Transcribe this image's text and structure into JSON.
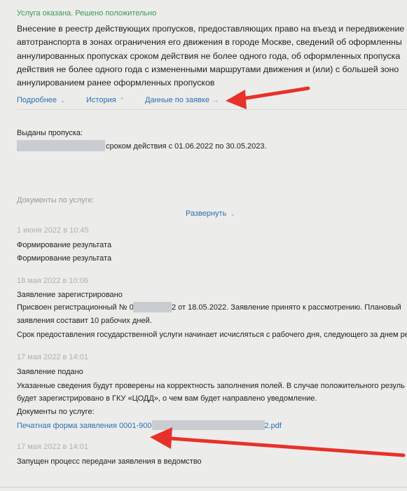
{
  "status": "Услуга оказана. Решено положительно",
  "title_lines": [
    "Внесение в реестр действующих пропусков, предоставляющих право на въезд и передвижение",
    "автотранспорта в зонах ограничения его движения в городе Москве, сведений об оформленны",
    "аннулированных пропусках сроком действия не более одного года, об оформленных пропуска",
    "действия не более одного года с измененными маршрутами движения и (или) с большей зоно",
    "аннулированием ранее оформленных пропусков"
  ],
  "links": {
    "more": "Подробнее",
    "history": "История",
    "request_data": "Данные по заявке",
    "request_arrow": "→"
  },
  "issued": {
    "label": "Выданы пропуска:",
    "text": "сроком действия с 01.06.2022 по 30.05.2023."
  },
  "documents_label": "Документы по услуге:",
  "expand": "Развернуть",
  "events": [
    {
      "date": "1 июня 2022 в 10:45",
      "lines": [
        "Формирование результата",
        "Формирование результата"
      ]
    },
    {
      "date": "18 мая 2022 в 10:06",
      "lines": [
        "Заявление зарегистрировано",
        "Присвоен регистрационный № 0",
        "2 от 18.05.2022. Заявление принято к рассмотрению. Плановый",
        "заявления составит 10 рабочих дней.",
        "Срок предоставления государственной услуги начинает исчисляться с рабочего дня, следующего за днем ре"
      ]
    },
    {
      "date": "17 мая 2022 в 14:01",
      "lines": [
        "Заявление подано",
        "Указанные сведения будут проверены на корректность заполнения полей. В случае положительного резуль",
        "будет зарегистрировано в ГКУ «ЦОДД», о чем вам будет направлено уведомление."
      ],
      "docs_label": "Документы по услуге:",
      "doc_link_start": "Печатная форма заявления 0001-900",
      "doc_link_end": "2.pdf"
    },
    {
      "date": "17 мая 2022 в 14:01",
      "lines": [
        "Запущен процесс передачи заявления в ведомство"
      ]
    }
  ],
  "colors": {
    "background": "#ececea",
    "status_green": "#3a9a57",
    "link_blue": "#2c6fb6",
    "arrow_red": "#e8312a",
    "redaction": "#c9cdd1"
  }
}
